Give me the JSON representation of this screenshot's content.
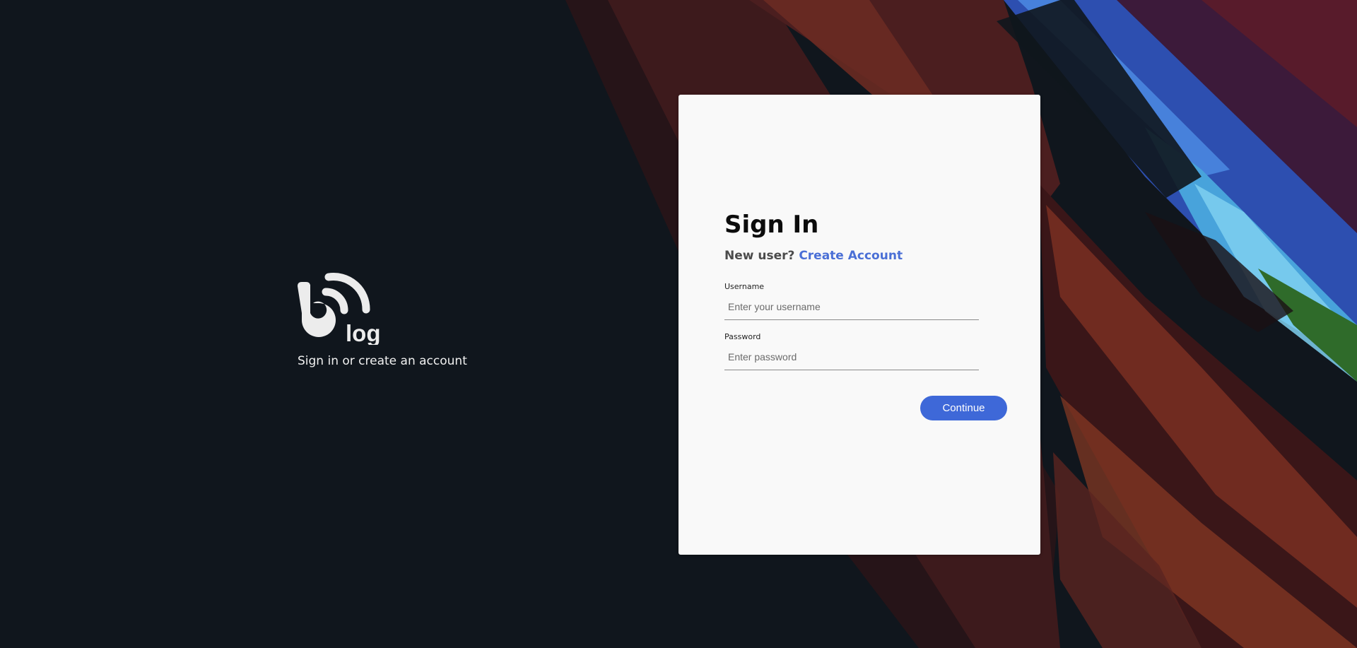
{
  "background": {
    "base_color": "#10161d",
    "accent_colors": [
      "#4b1e1f",
      "#7a2f22",
      "#2d4fb0",
      "#48a3db",
      "#3c1a3a",
      "#2f6b2a"
    ]
  },
  "brand": {
    "logo_icon": "blog-rss-logo-icon",
    "logo_text": "log",
    "tagline": "Sign in or create an account"
  },
  "signin": {
    "title": "Sign In",
    "new_user_prompt": "New user?",
    "create_account_link": "Create Account",
    "link_color": "#4a6fd6",
    "username": {
      "label": "Username",
      "placeholder": "Enter your username",
      "value": ""
    },
    "password": {
      "label": "Password",
      "placeholder": "Enter password",
      "value": ""
    },
    "continue_label": "Continue",
    "button_color": "#3e68d8"
  }
}
